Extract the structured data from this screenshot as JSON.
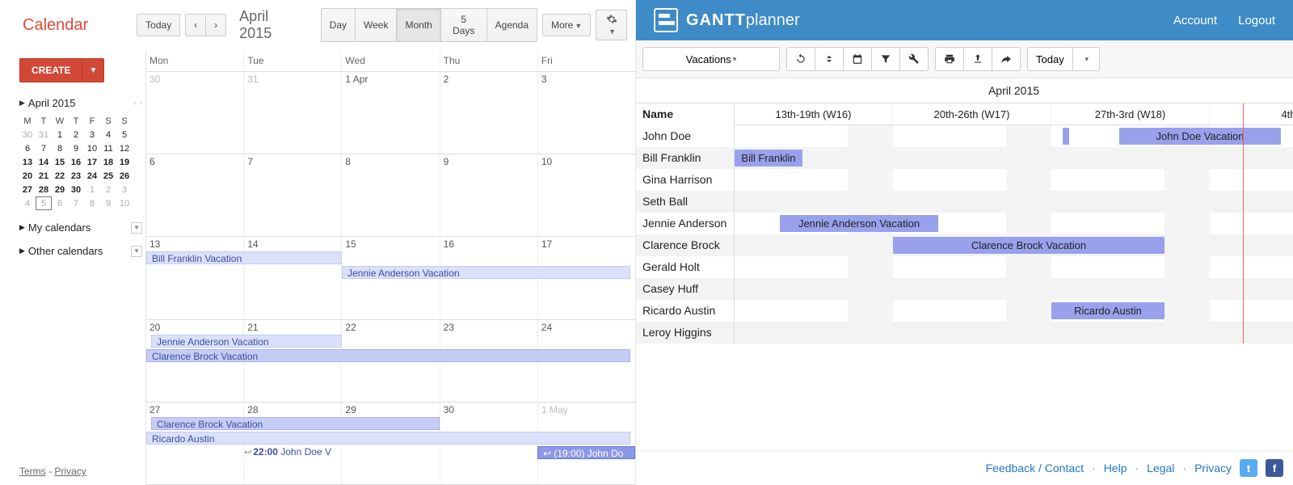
{
  "gcal": {
    "logo": "Calendar",
    "today_btn": "Today",
    "month_label": "April 2015",
    "views": {
      "day": "Day",
      "week": "Week",
      "month": "Month",
      "five_days": "5 Days",
      "agenda": "Agenda"
    },
    "more_btn": "More",
    "create_btn": "CREATE",
    "mini": {
      "title": "April 2015",
      "dow": [
        "M",
        "T",
        "W",
        "T",
        "F",
        "S",
        "S"
      ],
      "weeks": [
        [
          {
            "d": "30",
            "dim": true
          },
          {
            "d": "31",
            "dim": true
          },
          {
            "d": "1"
          },
          {
            "d": "2"
          },
          {
            "d": "3"
          },
          {
            "d": "4"
          },
          {
            "d": "5"
          }
        ],
        [
          {
            "d": "6"
          },
          {
            "d": "7"
          },
          {
            "d": "8"
          },
          {
            "d": "9"
          },
          {
            "d": "10"
          },
          {
            "d": "11"
          },
          {
            "d": "12"
          }
        ],
        [
          {
            "d": "13",
            "b": true
          },
          {
            "d": "14",
            "b": true
          },
          {
            "d": "15",
            "b": true
          },
          {
            "d": "16",
            "b": true
          },
          {
            "d": "17",
            "b": true
          },
          {
            "d": "18",
            "b": true
          },
          {
            "d": "19",
            "b": true
          }
        ],
        [
          {
            "d": "20",
            "b": true
          },
          {
            "d": "21",
            "b": true
          },
          {
            "d": "22",
            "b": true
          },
          {
            "d": "23",
            "b": true
          },
          {
            "d": "24",
            "b": true
          },
          {
            "d": "25",
            "b": true
          },
          {
            "d": "26",
            "b": true
          }
        ],
        [
          {
            "d": "27",
            "b": true
          },
          {
            "d": "28",
            "b": true
          },
          {
            "d": "29",
            "b": true
          },
          {
            "d": "30",
            "b": true
          },
          {
            "d": "1",
            "dim": true
          },
          {
            "d": "2",
            "dim": true
          },
          {
            "d": "3",
            "dim": true
          }
        ],
        [
          {
            "d": "4",
            "dim": true
          },
          {
            "d": "5",
            "dim": true,
            "border": true
          },
          {
            "d": "6",
            "dim": true
          },
          {
            "d": "7",
            "dim": true
          },
          {
            "d": "8",
            "dim": true
          },
          {
            "d": "9",
            "dim": true
          },
          {
            "d": "10",
            "dim": true
          }
        ]
      ]
    },
    "sections": {
      "my": "My calendars",
      "other": "Other calendars"
    },
    "footer": {
      "terms": "Terms",
      "privacy": "Privacy"
    },
    "dow": [
      "Mon",
      "Tue",
      "Wed",
      "Thu",
      "Fri"
    ],
    "grid_weeks": [
      [
        {
          "d": "30",
          "dim": true
        },
        {
          "d": "31",
          "dim": true
        },
        {
          "d": "1 Apr"
        },
        {
          "d": "2"
        },
        {
          "d": "3"
        }
      ],
      [
        {
          "d": "6"
        },
        {
          "d": "7"
        },
        {
          "d": "8"
        },
        {
          "d": "9"
        },
        {
          "d": "10"
        }
      ],
      [
        {
          "d": "13"
        },
        {
          "d": "14"
        },
        {
          "d": "15"
        },
        {
          "d": "16"
        },
        {
          "d": "17"
        }
      ],
      [
        {
          "d": "20"
        },
        {
          "d": "21"
        },
        {
          "d": "22"
        },
        {
          "d": "23"
        },
        {
          "d": "24"
        }
      ],
      [
        {
          "d": "27"
        },
        {
          "d": "28"
        },
        {
          "d": "29"
        },
        {
          "d": "30"
        },
        {
          "d": "1 May",
          "dim": true
        }
      ]
    ],
    "events": {
      "w2_bill": "Bill Franklin Vacation",
      "w2_jennie": "Jennie Anderson Vacation",
      "w3_jennie": "Jennie Anderson Vacation",
      "w3_clarence": "Clarence Brock Vacation",
      "w4_clarence": "Clarence Brock Vacation",
      "w4_ricardo": "Ricardo Austin",
      "w4_john_out_time": "22:00",
      "w4_john_out_name": "John Doe V",
      "w4_john_in": "(19:00) John Do"
    }
  },
  "gp": {
    "brand_bold": "GANTT",
    "brand_light": "planner",
    "account": "Account",
    "logout": "Logout",
    "dropdown": "Vacations",
    "today_btn": "Today",
    "month_title": "April 2015",
    "name_header": "Name",
    "weeks": [
      "13th-19th (W16)",
      "20th-26th (W17)",
      "27th-3rd (W18)",
      "4th"
    ],
    "people": [
      "John Doe",
      "Bill Franklin",
      "Gina Harrison",
      "Seth Ball",
      "Jennie Anderson",
      "Clarence Brock",
      "Gerald Holt",
      "Casey Huff",
      "Ricardo Austin",
      "Leroy Higgins"
    ],
    "bars": {
      "john_small": "",
      "john_vac": "John Doe Vacation",
      "bill": "Bill Franklin",
      "jennie": "Jennie Anderson Vacation",
      "clarence": "Clarence Brock Vacation",
      "ricardo": "Ricardo Austin"
    },
    "footer": {
      "feedback": "Feedback / Contact",
      "help": "Help",
      "legal": "Legal",
      "privacy": "Privacy"
    }
  }
}
